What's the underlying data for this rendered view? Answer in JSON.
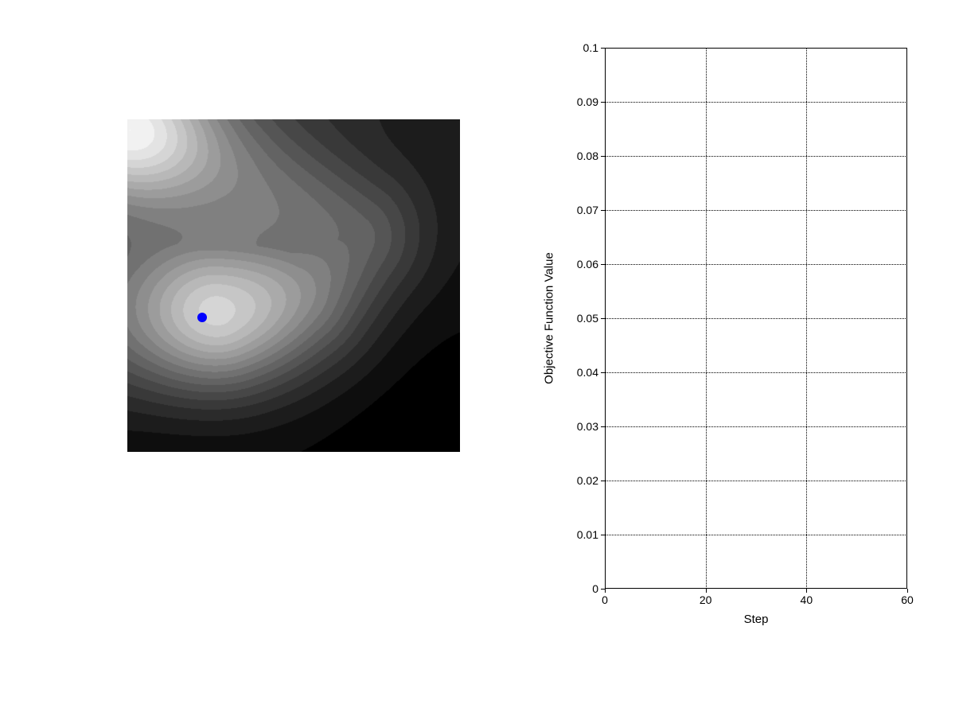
{
  "chart_data": [
    {
      "type": "heatmap",
      "description": "Grayscale objective-function landscape (lighter = higher). Two bright peaks: a partial one in the upper-left corner and a larger one in the lower-left quadrant, connected by a pale ridge curving through the centre.",
      "x_range": [
        0,
        1
      ],
      "y_range": [
        0,
        1
      ],
      "marker": {
        "x": 0.225,
        "y": 0.405,
        "color": "#0000ff",
        "label": "current point"
      }
    },
    {
      "type": "line",
      "title": "",
      "xlabel": "Step",
      "ylabel": "Objective Function Value",
      "xlim": [
        0,
        60
      ],
      "ylim": [
        0,
        0.1
      ],
      "x_ticks": [
        0,
        20,
        40,
        60
      ],
      "y_ticks": [
        0,
        0.01,
        0.02,
        0.03,
        0.04,
        0.05,
        0.06,
        0.07,
        0.08,
        0.09,
        0.1
      ],
      "y_tick_labels": [
        "0",
        "0.01",
        "0.02",
        "0.03",
        "0.04",
        "0.05",
        "0.06",
        "0.07",
        "0.08",
        "0.09",
        "0.1"
      ],
      "series": [],
      "grid": true
    }
  ],
  "labels": {
    "xlabel": "Step",
    "ylabel": "Objective Function Value"
  }
}
